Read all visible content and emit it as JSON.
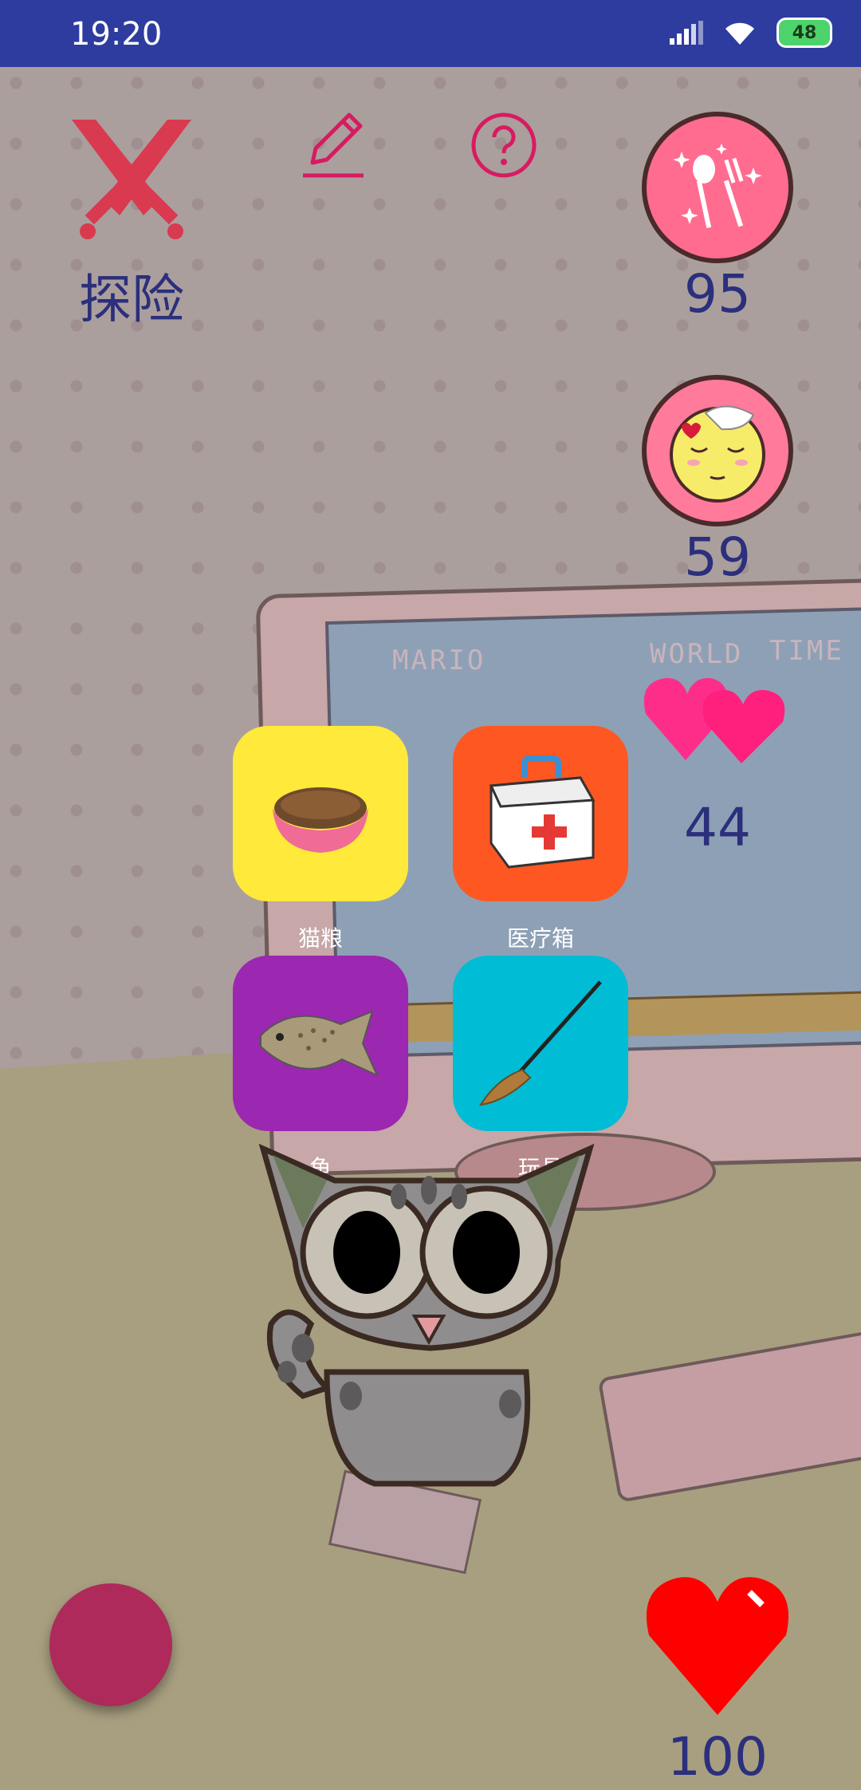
{
  "status_bar": {
    "time": "19:20",
    "battery": "48"
  },
  "explore": {
    "label": "探险",
    "icon": "crossed-swords-icon"
  },
  "toolbar": {
    "edit_icon": "pencil-icon",
    "help_icon": "help-circle-icon"
  },
  "stats": {
    "hunger": {
      "icon": "utensils-icon",
      "value": "95"
    },
    "mood": {
      "icon": "happy-face-icon",
      "value": "59"
    },
    "affection": {
      "icon": "double-heart-icon",
      "value": "44"
    },
    "health": {
      "icon": "heart-icon",
      "value": "100"
    }
  },
  "items": [
    {
      "label": "猫粮",
      "icon": "cat-food-bowl-icon",
      "color": "#FFE93B"
    },
    {
      "label": "医疗箱",
      "icon": "first-aid-kit-icon",
      "color": "#FF5722"
    },
    {
      "label": "鱼",
      "icon": "fish-icon",
      "color": "#9C27B0"
    },
    {
      "label": "玩具",
      "icon": "feather-wand-icon",
      "color": "#00BCD4"
    }
  ],
  "screen": {
    "line1": "MARIO",
    "line2": "WORLD",
    "line3": "TIME"
  },
  "colors": {
    "status_bar": "#2E3CA0",
    "accent_pink": "#D81B60",
    "stat_text": "#2B2F7C",
    "fab": "#AD2A5A"
  }
}
